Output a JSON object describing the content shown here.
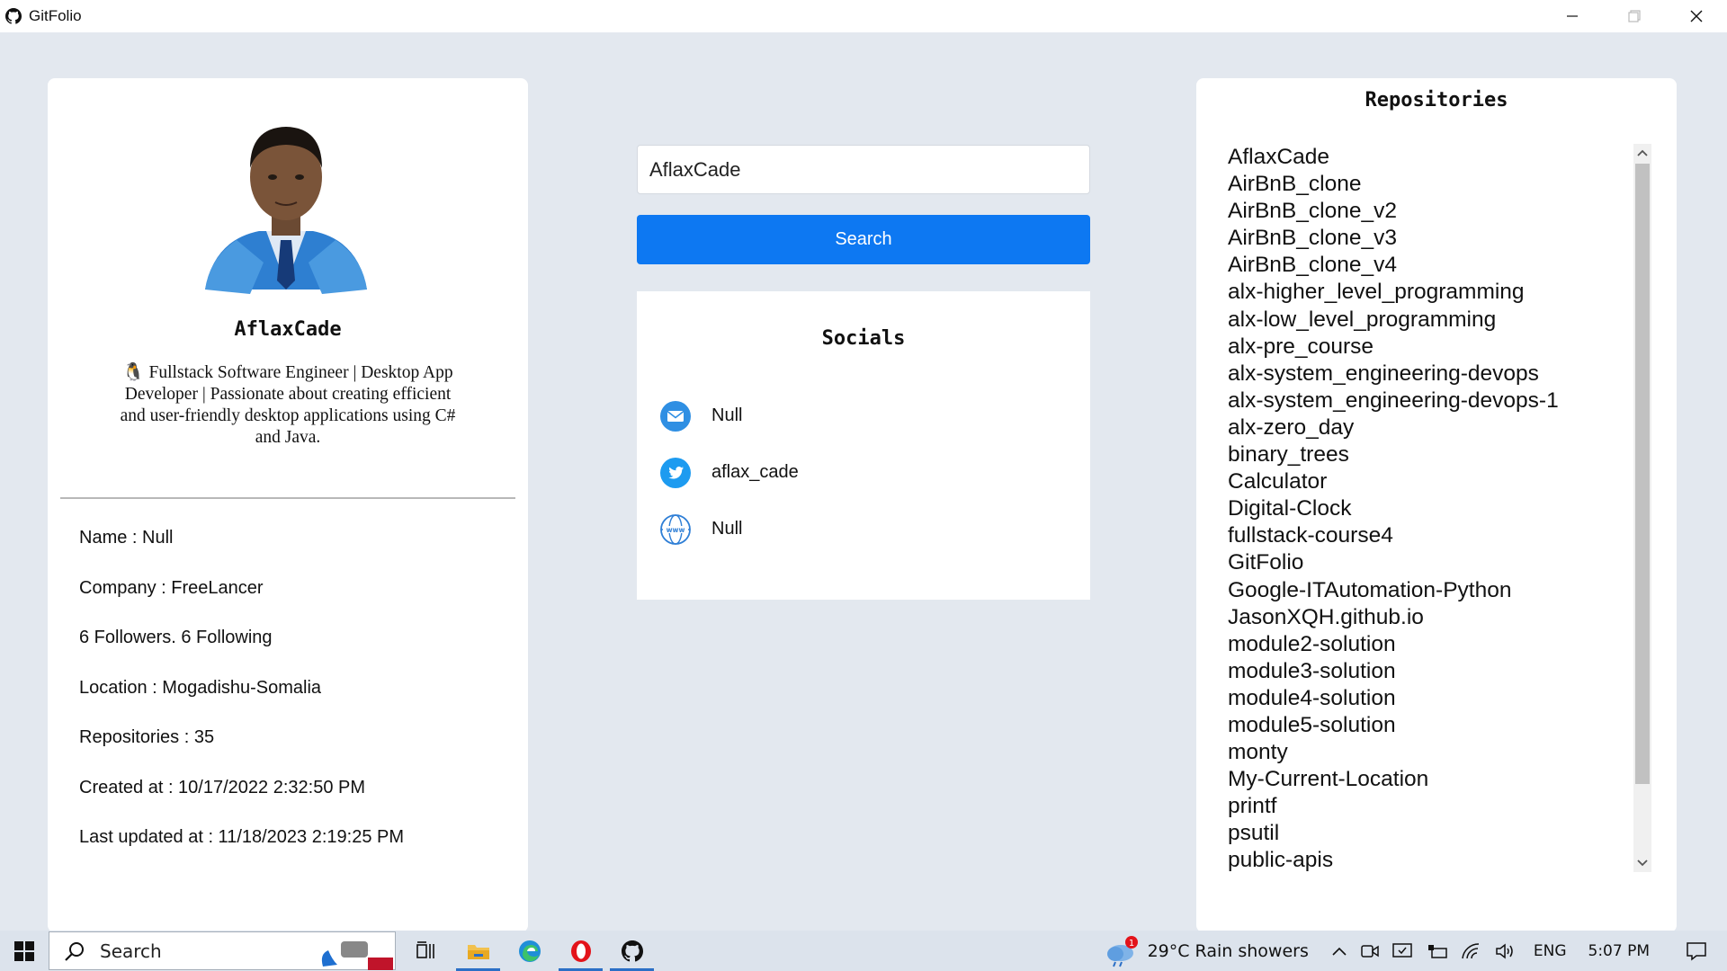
{
  "window": {
    "title": "GitFolio"
  },
  "profile": {
    "username": "AflaxCade",
    "bio": "🐧 Fullstack Software Engineer | Desktop App Developer | Passionate about creating efficient and user-friendly desktop applications using C# and Java.",
    "info": [
      "Name : Null",
      "Company : FreeLancer",
      "6 Followers. 6 Following",
      "Location : Mogadishu-Somalia",
      "Repositories : 35",
      "Created at : 10/17/2022 2:32:50 PM",
      "Last updated at : 11/18/2023 2:19:25 PM"
    ]
  },
  "search": {
    "value": "AflaxCade",
    "button_label": "Search"
  },
  "socials": {
    "title": "Socials",
    "email": "Null",
    "twitter": "aflax_cade",
    "website": "Null"
  },
  "repositories": {
    "title": "Repositories",
    "items": [
      "AflaxCade",
      "AirBnB_clone",
      "AirBnB_clone_v2",
      "AirBnB_clone_v3",
      "AirBnB_clone_v4",
      "alx-higher_level_programming",
      "alx-low_level_programming",
      "alx-pre_course",
      "alx-system_engineering-devops",
      "alx-system_engineering-devops-1",
      "alx-zero_day",
      "binary_trees",
      "Calculator",
      "Digital-Clock",
      "fullstack-course4",
      "GitFolio",
      "Google-ITAutomation-Python",
      "JasonXQH.github.io",
      "module2-solution",
      "module3-solution",
      "module4-solution",
      "module5-solution",
      "monty",
      "My-Current-Location",
      "printf",
      "psutil",
      "public-apis"
    ]
  },
  "taskbar": {
    "search_label": "Search",
    "weather": "29°C  Rain showers",
    "weather_badge": "1",
    "language": "ENG",
    "time": "5:07 PM"
  },
  "colors": {
    "accent": "#0d78f2",
    "background": "#e3e8ef"
  }
}
